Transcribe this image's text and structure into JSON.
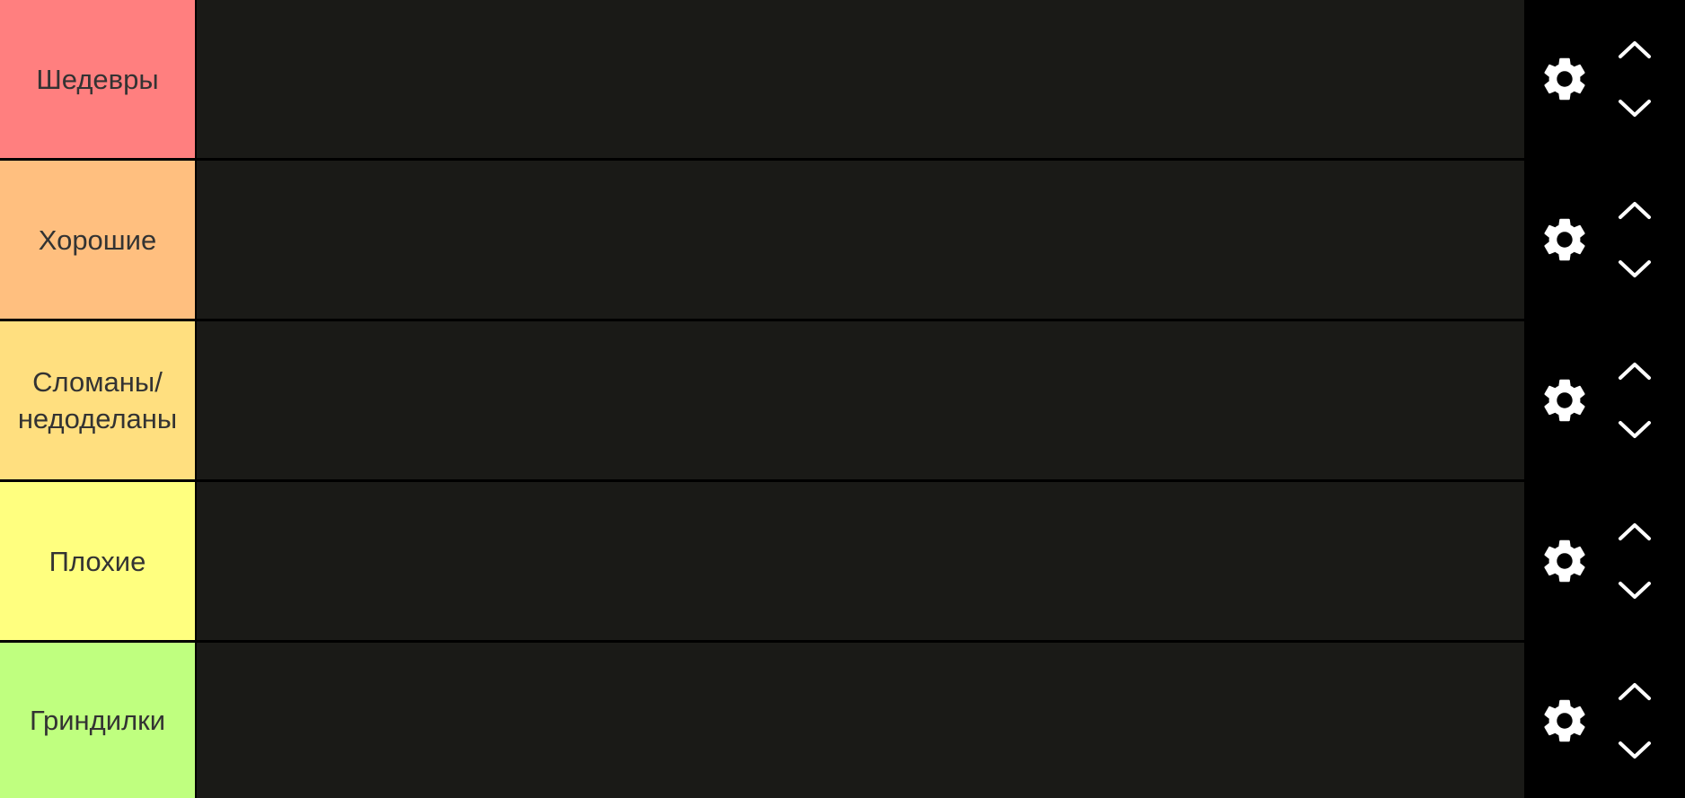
{
  "tiers": [
    {
      "label": "Шедевры",
      "color": "#ff7f7f"
    },
    {
      "label": "Хорошие",
      "color": "#ffbf7f"
    },
    {
      "label": "Сломаны/ недоделаны",
      "color": "#ffdf7f"
    },
    {
      "label": "Плохие",
      "color": "#ffff7f"
    },
    {
      "label": "Гриндилки",
      "color": "#bfff7f"
    }
  ],
  "controls": {
    "settings_icon": "gear-icon",
    "move_up_icon": "chevron-up-icon",
    "move_down_icon": "chevron-down-icon"
  },
  "colors": {
    "row_background": "#1a1a17",
    "page_background": "#000000",
    "label_text": "#333333",
    "icon_color": "#ffffff"
  }
}
